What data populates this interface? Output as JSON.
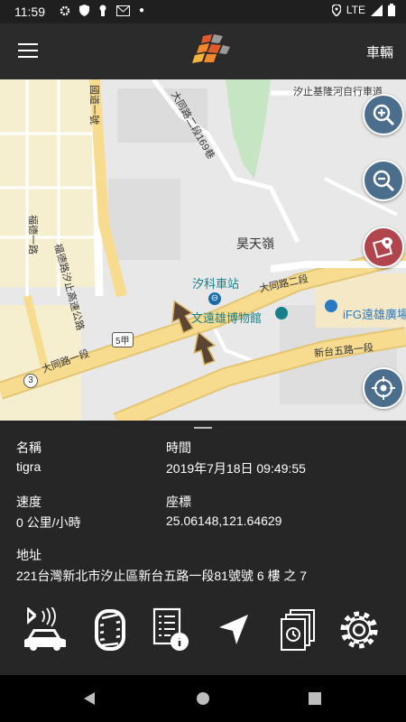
{
  "status_bar": {
    "time": "11:59",
    "network": "LTE"
  },
  "app_bar": {
    "vehicle_button": "車輛"
  },
  "map": {
    "labels": {
      "road_top": "汐止基隆河自行車道",
      "road_a": "大同路二段169巷",
      "road_b": "國道一號",
      "road_c": "福德一路",
      "road_d": "福德路汐止高速公路",
      "hill": "昊天嶺",
      "station": "汐科車站",
      "road_e": "大同路二段",
      "museum": "文遠雄博物館",
      "ifg": "iFG遠雄廣場",
      "road_f": "大同路一段",
      "road_g": "新台五路一段",
      "shield_5": "5甲",
      "shield_3": "3"
    }
  },
  "details": {
    "name_label": "名稱",
    "name_value": "tigra",
    "time_label": "時間",
    "time_value": "2019年7月18日 09:49:55",
    "speed_label": "速度",
    "speed_value": "0 公里/小時",
    "coord_label": "座標",
    "coord_value": "25.06148,121.64629",
    "address_label": "地址",
    "address_value": "221台灣新北市汐止區新台五路一段81號號 6 樓 之 7"
  },
  "colors": {
    "app_bar": "#2b2b2b",
    "panel": "#262626",
    "zoom_buttons": "#4b6e8c",
    "map_mode_button": "#b0454e",
    "road": "#f5d98c"
  }
}
